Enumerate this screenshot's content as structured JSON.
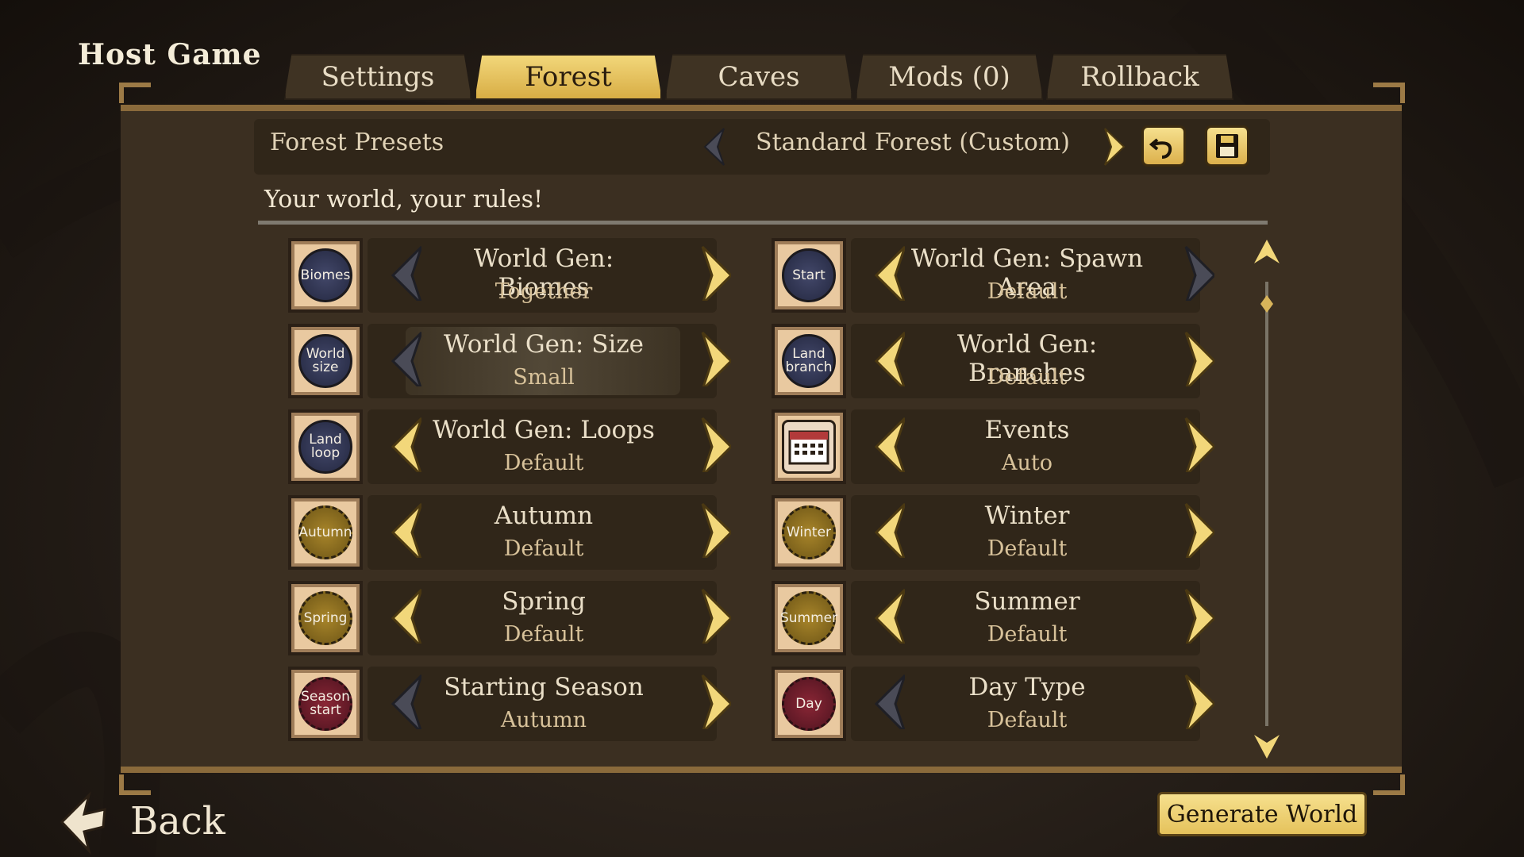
{
  "screen_title": "Host Game",
  "tabs": [
    {
      "label": "Settings",
      "active": false
    },
    {
      "label": "Forest",
      "active": true
    },
    {
      "label": "Caves",
      "active": false
    },
    {
      "label": "Mods (0)",
      "active": false
    },
    {
      "label": "Rollback",
      "active": false
    }
  ],
  "presets": {
    "label": "Forest Presets",
    "value": "Standard Forest (Custom)",
    "revert_icon": "undo-arrow-icon",
    "save_icon": "floppy-disk-icon"
  },
  "tagline": "Your world, your rules!",
  "options": [
    {
      "icon_text": "Biomes",
      "icon_style": "blue",
      "title": "World Gen: Biomes",
      "value": "Together",
      "left_enabled": false,
      "right_enabled": true
    },
    {
      "icon_text": "Start",
      "icon_style": "blue",
      "title": "World Gen: Spawn Area",
      "value": "Default",
      "left_enabled": true,
      "right_enabled": false
    },
    {
      "icon_text": "World size",
      "icon_style": "blue",
      "title": "World Gen: Size",
      "value": "Small",
      "left_enabled": false,
      "right_enabled": true,
      "highlighted": true
    },
    {
      "icon_text": "Land branch",
      "icon_style": "blue",
      "title": "World Gen: Branches",
      "value": "Default",
      "left_enabled": true,
      "right_enabled": true
    },
    {
      "icon_text": "Land loop",
      "icon_style": "blue",
      "title": "World Gen: Loops",
      "value": "Default",
      "left_enabled": true,
      "right_enabled": true
    },
    {
      "icon_text": "",
      "icon_style": "calendar",
      "title": "Events",
      "value": "Auto",
      "left_enabled": true,
      "right_enabled": true
    },
    {
      "icon_text": "Autumn",
      "icon_style": "gold",
      "title": "Autumn",
      "value": "Default",
      "left_enabled": true,
      "right_enabled": true
    },
    {
      "icon_text": "Winter",
      "icon_style": "gold",
      "title": "Winter",
      "value": "Default",
      "left_enabled": true,
      "right_enabled": true
    },
    {
      "icon_text": "Spring",
      "icon_style": "gold",
      "title": "Spring",
      "value": "Default",
      "left_enabled": true,
      "right_enabled": true
    },
    {
      "icon_text": "Summer",
      "icon_style": "gold",
      "title": "Summer",
      "value": "Default",
      "left_enabled": true,
      "right_enabled": true
    },
    {
      "icon_text": "Season start",
      "icon_style": "red",
      "title": "Starting Season",
      "value": "Autumn",
      "left_enabled": false,
      "right_enabled": true
    },
    {
      "icon_text": "Day",
      "icon_style": "red",
      "title": "Day Type",
      "value": "Default",
      "left_enabled": false,
      "right_enabled": true
    }
  ],
  "back_label": "Back",
  "generate_label": "Generate World",
  "colors": {
    "accent_gold": "#e5c25c",
    "panel": "#3b2f21",
    "arrow_enabled": "#f2d77a",
    "arrow_disabled": "#4a4b57"
  }
}
